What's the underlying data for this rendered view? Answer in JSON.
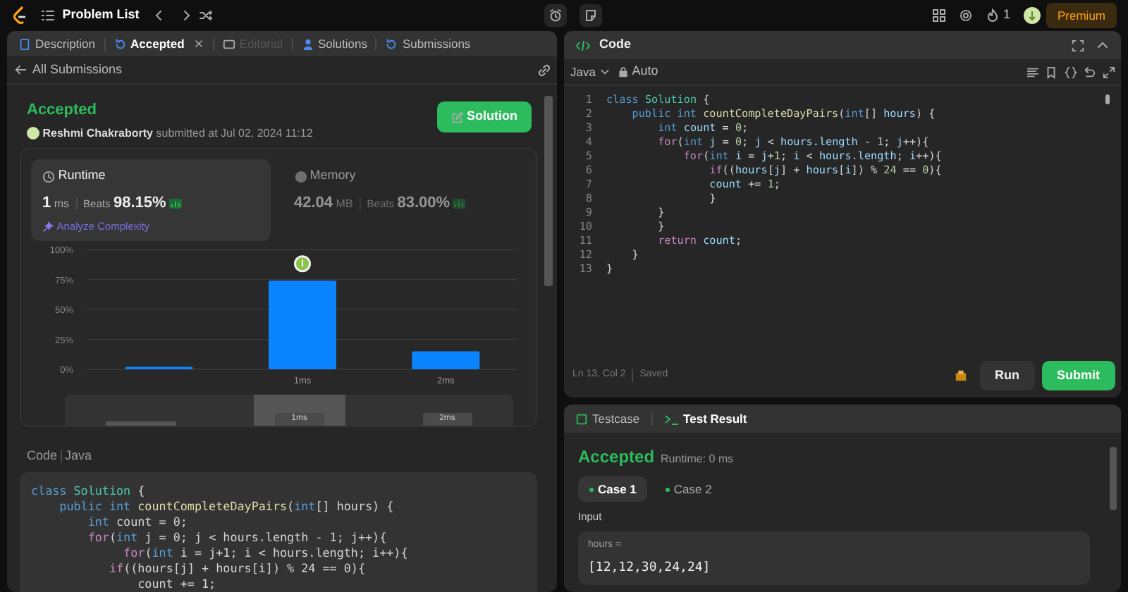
{
  "top_bar": {
    "title": "Problem List",
    "streak": "1",
    "premium": "Premium"
  },
  "tabs": [
    {
      "label": "Description",
      "kind": "description",
      "selected": false,
      "disabled": false,
      "closable": false
    },
    {
      "label": "Accepted",
      "kind": "accepted",
      "selected": true,
      "disabled": false,
      "closable": true
    },
    {
      "label": "Editorial",
      "kind": "editorial",
      "selected": false,
      "disabled": true,
      "closable": false
    },
    {
      "label": "Solutions",
      "kind": "solutions",
      "selected": false,
      "disabled": false,
      "closable": false
    },
    {
      "label": "Submissions",
      "kind": "submissions",
      "selected": false,
      "disabled": false,
      "closable": false
    }
  ],
  "submission": {
    "back_label": "All Submissions",
    "status": "Accepted",
    "author": "Reshmi Chakraborty",
    "submitted": "submitted at Jul 02, 2024 11:12",
    "solution_button": "Solution"
  },
  "stats": [
    {
      "kind": "runtime",
      "title": "Runtime",
      "value": "1",
      "unit": "ms",
      "beats_label": "Beats",
      "beats": "98.15%",
      "selected": true,
      "link": "Analyze Complexity"
    },
    {
      "kind": "memory",
      "title": "Memory",
      "value": "42.04",
      "unit": "MB",
      "beats_label": "Beats",
      "beats": "83.00%",
      "selected": false
    }
  ],
  "chart_data": {
    "type": "bar",
    "categories": [
      null,
      "1ms",
      "2ms"
    ],
    "values": [
      2,
      74,
      15
    ],
    "ylim": [
      0,
      100
    ],
    "grid": true,
    "yticks": [
      {
        "value": 0,
        "label": "0%"
      },
      {
        "value": 25,
        "label": "25%"
      },
      {
        "value": 50,
        "label": "50%"
      },
      {
        "value": 75,
        "label": "75%"
      },
      {
        "value": 100,
        "label": "100%"
      }
    ]
  },
  "range_selector": {
    "slots": [
      {
        "selected": false
      },
      {
        "label": "1ms",
        "selected": true
      },
      {
        "label": "2ms",
        "selected": false
      }
    ]
  },
  "code_section": {
    "label": "Code",
    "language": "Java",
    "lines": [
      [
        {
          "kind": "kw",
          "text": "class "
        },
        {
          "kind": "type",
          "text": "Solution "
        },
        {
          "kind": "plain",
          "text": "{"
        }
      ],
      [
        {
          "kind": "kw",
          "text": "    public int "
        },
        {
          "kind": "fn",
          "text": "countCompleteDayPairs"
        },
        {
          "kind": "plain",
          "text": "("
        },
        {
          "kind": "kw",
          "text": "int"
        },
        {
          "kind": "plain",
          "text": "[] hours) {"
        }
      ],
      [
        {
          "kind": "kw",
          "text": "        int "
        },
        {
          "kind": "plain",
          "text": "count = 0;"
        }
      ],
      [
        {
          "kind": "ctrl",
          "text": "        for"
        },
        {
          "kind": "plain",
          "text": "("
        },
        {
          "kind": "kw",
          "text": "int "
        },
        {
          "kind": "plain",
          "text": "j = 0; j < hours.length - 1; j++){"
        }
      ],
      [
        {
          "kind": "ctrl",
          "text": "             for"
        },
        {
          "kind": "plain",
          "text": "("
        },
        {
          "kind": "kw",
          "text": "int "
        },
        {
          "kind": "plain",
          "text": "i = j+1; i < hours.length; i++){"
        }
      ],
      [
        {
          "kind": "ctrl",
          "text": "           if"
        },
        {
          "kind": "plain",
          "text": "((hours[j] + hours[i]) % 24 == 0){"
        }
      ],
      [
        {
          "kind": "plain",
          "text": "               count += 1;"
        }
      ]
    ]
  },
  "editor": {
    "title": "Code",
    "language": "Java",
    "mode": "Auto",
    "cursor": "Ln 13, Col 2",
    "saved": "Saved",
    "run": "Run",
    "submit": "Submit",
    "lines": [
      {
        "number": "1",
        "tokens": [
          {
            "kind": "kw",
            "text": "class "
          },
          {
            "kind": "type",
            "text": "Solution "
          },
          {
            "kind": "plain",
            "text": "{"
          }
        ]
      },
      {
        "number": "2",
        "tokens": [
          {
            "kind": "kw",
            "text": "    public int "
          },
          {
            "kind": "fn",
            "text": "countCompleteDayPairs"
          },
          {
            "kind": "plain",
            "text": "("
          },
          {
            "kind": "kw",
            "text": "int"
          },
          {
            "kind": "plain",
            "text": "[] "
          },
          {
            "kind": "var",
            "text": "hours"
          },
          {
            "kind": "plain",
            "text": ") {"
          }
        ]
      },
      {
        "number": "3",
        "tokens": [
          {
            "kind": "kw",
            "text": "        int "
          },
          {
            "kind": "var",
            "text": "count"
          },
          {
            "kind": "plain",
            "text": " = "
          },
          {
            "kind": "num",
            "text": "0"
          },
          {
            "kind": "plain",
            "text": ";"
          }
        ]
      },
      {
        "number": "4",
        "tokens": [
          {
            "kind": "ctrl",
            "text": "        for"
          },
          {
            "kind": "plain",
            "text": "("
          },
          {
            "kind": "kw",
            "text": "int "
          },
          {
            "kind": "var",
            "text": "j"
          },
          {
            "kind": "plain",
            "text": " = "
          },
          {
            "kind": "num",
            "text": "0"
          },
          {
            "kind": "plain",
            "text": "; "
          },
          {
            "kind": "var",
            "text": "j"
          },
          {
            "kind": "plain",
            "text": " < "
          },
          {
            "kind": "var",
            "text": "hours"
          },
          {
            "kind": "plain",
            "text": "."
          },
          {
            "kind": "var",
            "text": "length"
          },
          {
            "kind": "plain",
            "text": " - "
          },
          {
            "kind": "num",
            "text": "1"
          },
          {
            "kind": "plain",
            "text": "; "
          },
          {
            "kind": "var",
            "text": "j"
          },
          {
            "kind": "plain",
            "text": "++){"
          }
        ]
      },
      {
        "number": "5",
        "tokens": [
          {
            "kind": "ctrl",
            "text": "            for"
          },
          {
            "kind": "plain",
            "text": "("
          },
          {
            "kind": "kw",
            "text": "int "
          },
          {
            "kind": "var",
            "text": "i"
          },
          {
            "kind": "plain",
            "text": " = "
          },
          {
            "kind": "var",
            "text": "j"
          },
          {
            "kind": "plain",
            "text": "+"
          },
          {
            "kind": "num",
            "text": "1"
          },
          {
            "kind": "plain",
            "text": "; "
          },
          {
            "kind": "var",
            "text": "i"
          },
          {
            "kind": "plain",
            "text": " < "
          },
          {
            "kind": "var",
            "text": "hours"
          },
          {
            "kind": "plain",
            "text": "."
          },
          {
            "kind": "var",
            "text": "length"
          },
          {
            "kind": "plain",
            "text": "; "
          },
          {
            "kind": "var",
            "text": "i"
          },
          {
            "kind": "plain",
            "text": "++){"
          }
        ]
      },
      {
        "number": "6",
        "tokens": [
          {
            "kind": "ctrl",
            "text": "                if"
          },
          {
            "kind": "plain",
            "text": "(("
          },
          {
            "kind": "var",
            "text": "hours"
          },
          {
            "kind": "plain",
            "text": "["
          },
          {
            "kind": "var",
            "text": "j"
          },
          {
            "kind": "plain",
            "text": "] + "
          },
          {
            "kind": "var",
            "text": "hours"
          },
          {
            "kind": "plain",
            "text": "["
          },
          {
            "kind": "var",
            "text": "i"
          },
          {
            "kind": "plain",
            "text": "]) % "
          },
          {
            "kind": "num",
            "text": "24"
          },
          {
            "kind": "plain",
            "text": " == "
          },
          {
            "kind": "num",
            "text": "0"
          },
          {
            "kind": "plain",
            "text": "){"
          }
        ]
      },
      {
        "number": "7",
        "tokens": [
          {
            "kind": "var",
            "text": "                count"
          },
          {
            "kind": "plain",
            "text": " += "
          },
          {
            "kind": "num",
            "text": "1"
          },
          {
            "kind": "plain",
            "text": ";"
          }
        ]
      },
      {
        "number": "8",
        "tokens": [
          {
            "kind": "plain",
            "text": "                }"
          }
        ]
      },
      {
        "number": "9",
        "tokens": [
          {
            "kind": "plain",
            "text": "        }"
          }
        ]
      },
      {
        "number": "10",
        "tokens": [
          {
            "kind": "plain",
            "text": "        }"
          }
        ]
      },
      {
        "number": "11",
        "tokens": [
          {
            "kind": "ctrl",
            "text": "        return "
          },
          {
            "kind": "var",
            "text": "count"
          },
          {
            "kind": "plain",
            "text": ";"
          }
        ]
      },
      {
        "number": "12",
        "tokens": [
          {
            "kind": "plain",
            "text": "    }"
          }
        ]
      },
      {
        "number": "13",
        "tokens": [
          {
            "kind": "plain",
            "text": "}"
          }
        ]
      }
    ]
  },
  "test_panel": {
    "tabs": [
      {
        "label": "Testcase",
        "selected": false
      },
      {
        "label": "Test Result",
        "selected": true
      }
    ],
    "status": "Accepted",
    "runtime": "Runtime: 0 ms",
    "cases": [
      {
        "label": "Case 1",
        "selected": true
      },
      {
        "label": "Case 2",
        "selected": false
      }
    ],
    "input_label": "Input",
    "param": "hours =",
    "value": "[12,12,30,24,24]"
  }
}
